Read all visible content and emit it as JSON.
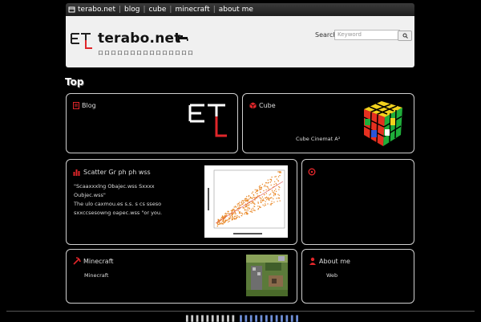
{
  "nav": {
    "site_label": "terabo.net",
    "items": [
      {
        "label": "blog"
      },
      {
        "label": "cube"
      },
      {
        "label": "minecraft"
      },
      {
        "label": "about me"
      }
    ]
  },
  "header": {
    "title": "terabo.net",
    "tagline": "ロロロロロロロロロロロロロロロ",
    "search_label": "Search",
    "search_placeholder": "Keyword"
  },
  "section_title": "Top",
  "cards": {
    "blog": {
      "title": "Blog"
    },
    "cube": {
      "title": "Cube",
      "caption": "Cube Cinemat A²"
    },
    "stats": {
      "title": "Scatter   Gr  ph  ph   wss",
      "line1": "\"Scaaxxxlng   Obajec.wss   Sxxxx",
      "line2": "Oubjec.wss\"",
      "line3": " The  ulo  caxmou.es  s.s.  s  cs  sseso",
      "line4": "  sxxccsesowng  oapec.wss  \"or you."
    },
    "minecraft": {
      "title": "Minecraft",
      "text": "Minecraft"
    },
    "about": {
      "title": "About me",
      "text": "Web"
    }
  },
  "footer": {
    "text_a": "▌▌▌▌▌▌▌▌▌▌ ",
    "text_b": "▌▌▌▌▌▌▌▌▌▌▌▌"
  },
  "colors": {
    "background": "#000000",
    "accent_red": "#e0262a",
    "link_blue": "#6f8fd8"
  }
}
